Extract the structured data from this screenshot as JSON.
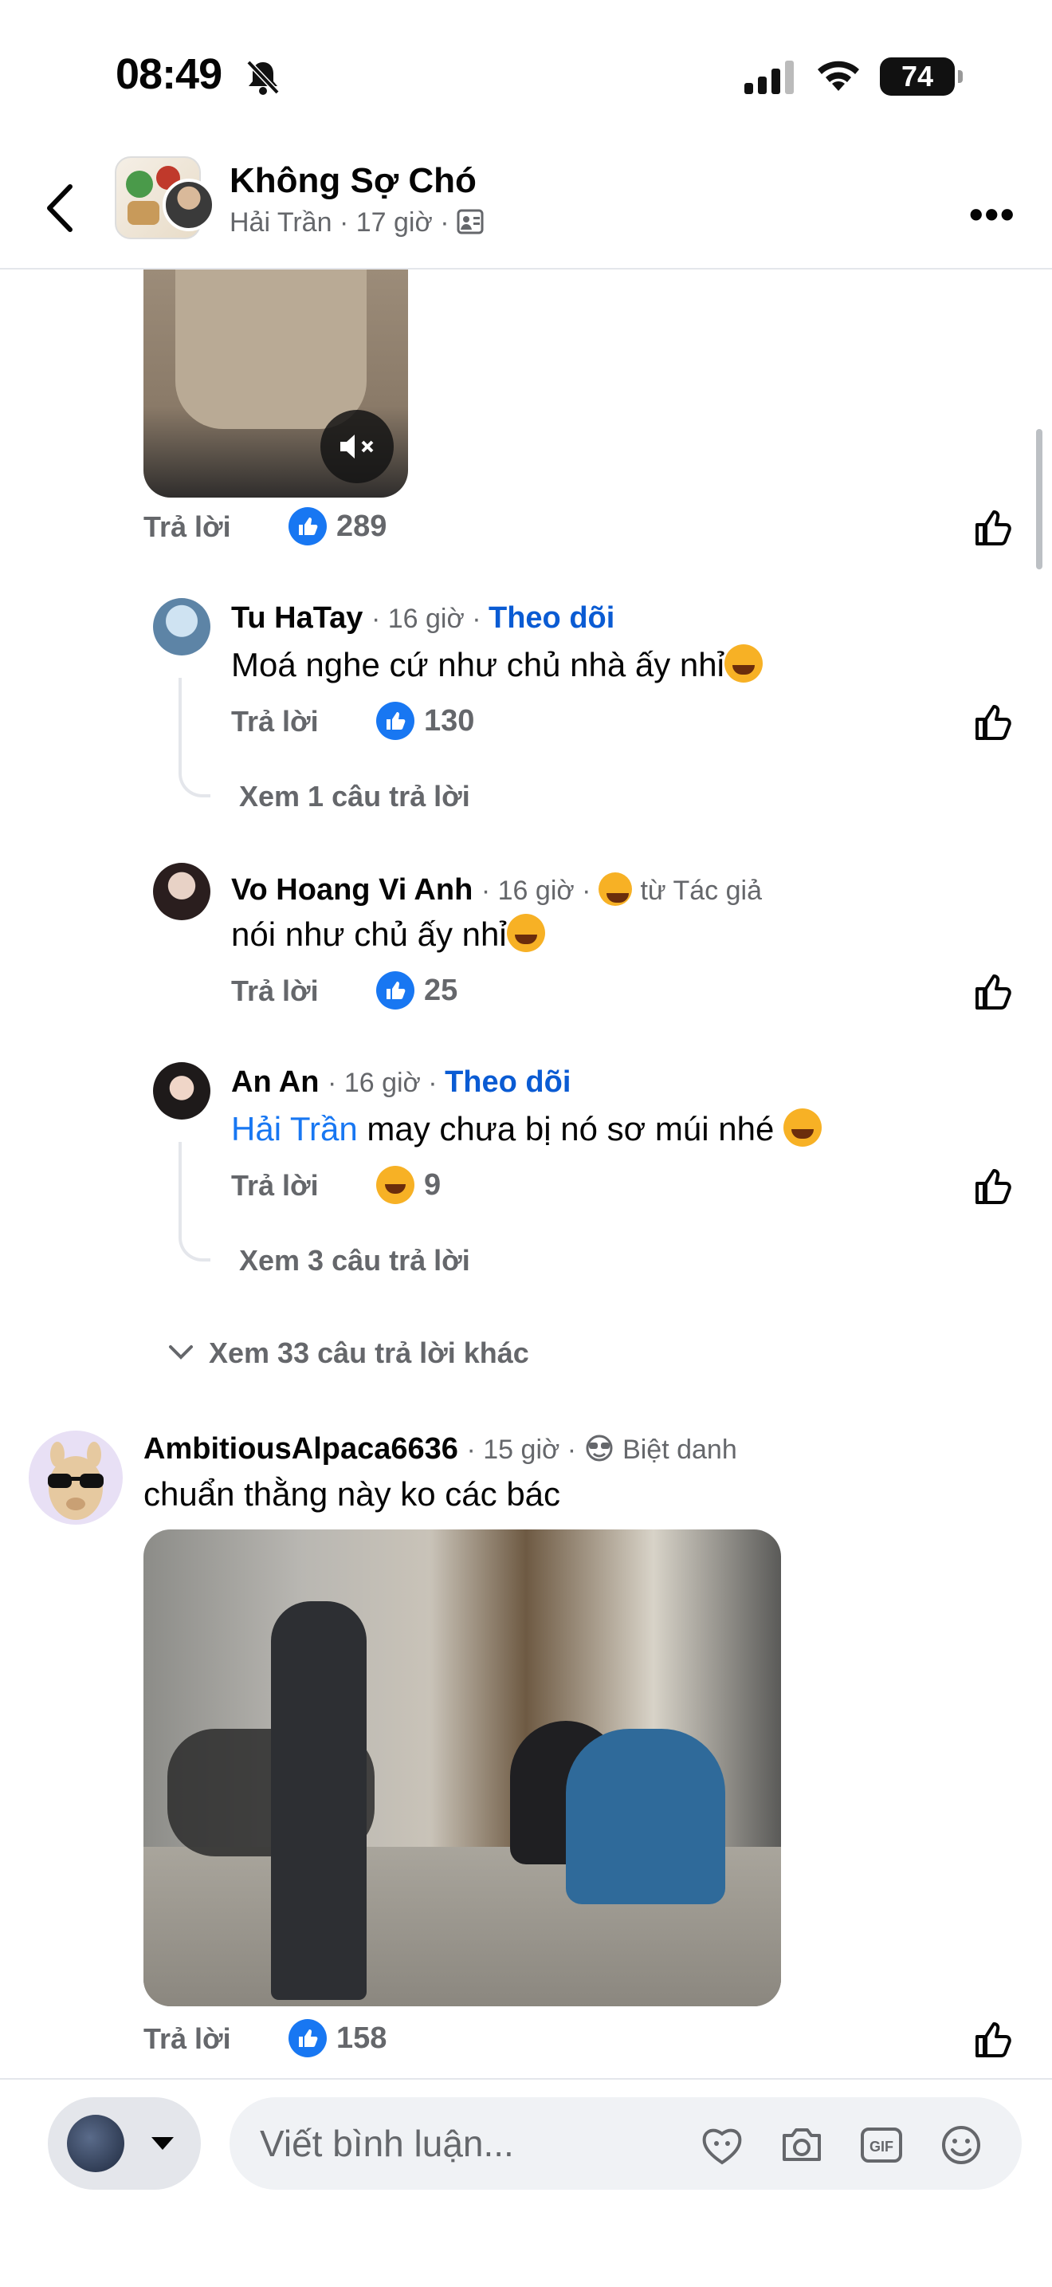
{
  "status_bar": {
    "time": "08:49",
    "battery": "74"
  },
  "header": {
    "group_name": "Không Sợ Chó",
    "author": "Hải Trần",
    "time": "17 giờ",
    "separator": "·"
  },
  "top_comment_actions": {
    "reply": "Trả lời",
    "like_count": "289"
  },
  "replies": [
    {
      "name": "Tu HaTay",
      "time": "16 giờ",
      "follow": "Theo dõi",
      "text": "Moá nghe cứ như chủ nhà ấy nhỉ",
      "reply": "Trả lời",
      "reaction": "like",
      "count": "130",
      "see_more": "Xem 1 câu trả lời"
    },
    {
      "name": "Vo Hoang Vi Anh",
      "time": "16 giờ",
      "badge": "từ Tác giả",
      "text": "nói như chủ ấy nhỉ",
      "reply": "Trả lời",
      "reaction": "like",
      "count": "25"
    },
    {
      "name": "An An",
      "time": "16 giờ",
      "follow": "Theo dõi",
      "mention": "Hải Trần",
      "text": "may chưa bị nó sơ múi nhé",
      "reply": "Trả lời",
      "reaction": "haha",
      "count": "9",
      "see_more": "Xem 3 câu trả lời"
    }
  ],
  "more_replies": "Xem 33 câu trả lời khác",
  "comment2": {
    "name": "AmbitiousAlpaca6636",
    "time": "15 giờ",
    "badge": "Biệt danh",
    "text": "chuẩn thằng này ko các bác",
    "reply": "Trả lời",
    "like_count": "158"
  },
  "composer": {
    "placeholder": "Viết bình luận..."
  },
  "colors": {
    "accent": "#1877f2",
    "follow": "#0a5bd3",
    "meta": "#65676b",
    "haha": "#f7b125"
  },
  "icons": [
    "back-arrow-icon",
    "bell-off-icon",
    "signal-icon",
    "wifi-icon",
    "more-icon",
    "mute-icon",
    "like-icon",
    "haha-icon",
    "sunglasses-icon",
    "avatar-sticker-icon",
    "camera-icon",
    "gif-icon",
    "emoji-icon",
    "chevron-down-icon"
  ]
}
